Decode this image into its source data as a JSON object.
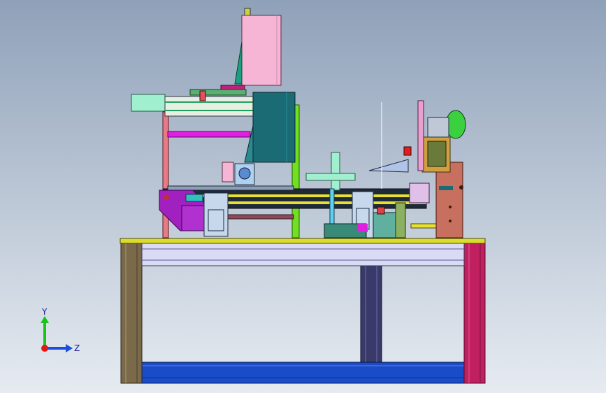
{
  "viewport": {
    "background_top": "#8fa1b9",
    "background_bottom": "#e6ebf1"
  },
  "triad": {
    "y_label": "Y",
    "z_label": "Z",
    "y_color": "#18c418",
    "z_color": "#1a4ee0",
    "origin_color": "#e01818"
  },
  "model": {
    "colors": {
      "table_top": "#dcdc2c",
      "table_rail": "#d9dbf5",
      "leg_left": "#7a6a4a",
      "leg_right": "#c02060",
      "bottom_beam": "#1a4cc8",
      "center_post": "#3a3a6a",
      "pink_cylinder": "#f7b5d6",
      "teal_block": "#1b6b75",
      "magenta_rod": "#e020e0",
      "purple_bracket": "#a020c0",
      "green_wheel": "#3ad040",
      "salmon_block": "#c87060",
      "yellow_rail": "#e8e030"
    }
  }
}
